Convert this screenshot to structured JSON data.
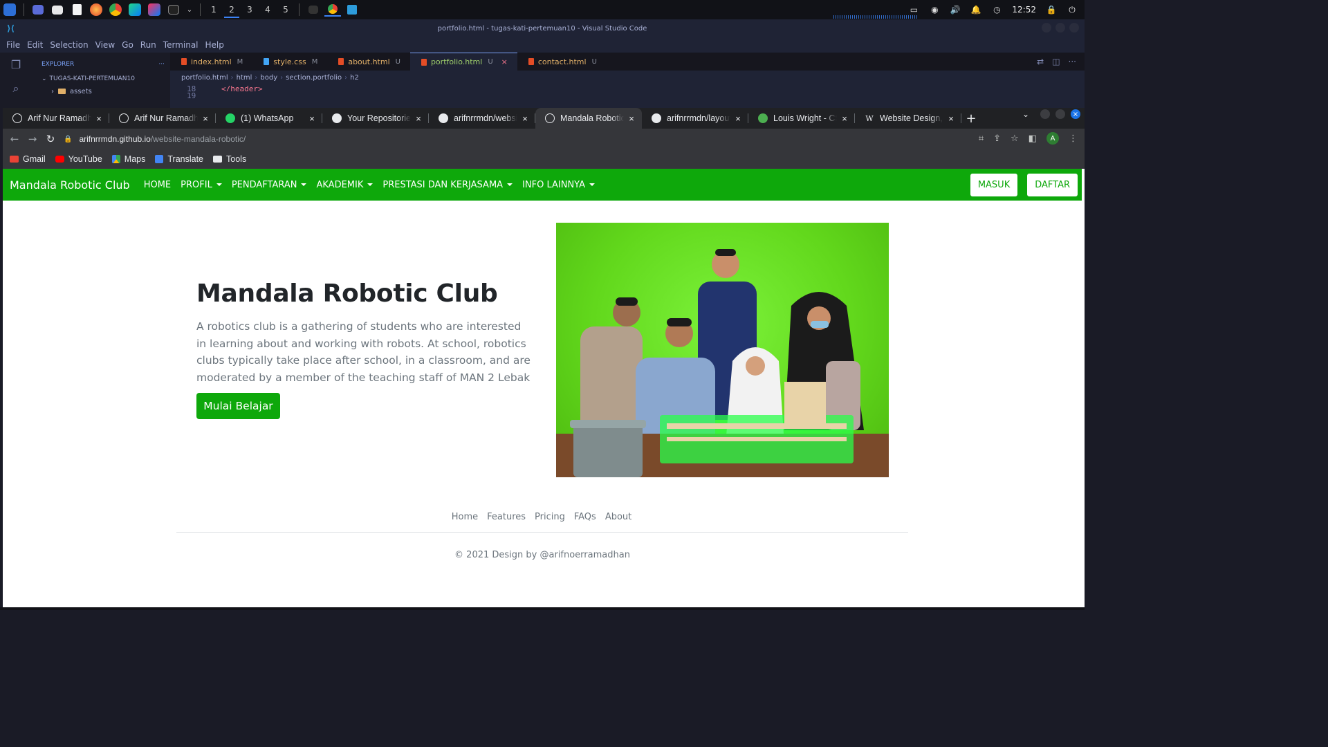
{
  "os": {
    "workspaces": [
      "1",
      "2",
      "3",
      "4",
      "5"
    ],
    "active_workspace": "2",
    "clock": "12:52"
  },
  "vscode": {
    "title": "portfolio.html - tugas-kati-pertemuan10 - Visual Studio Code",
    "menu": [
      "File",
      "Edit",
      "Selection",
      "View",
      "Go",
      "Run",
      "Terminal",
      "Help"
    ],
    "explorer_label": "EXPLORER",
    "explorer_more": "···",
    "project": "TUGAS-KATI-PERTEMUAN10",
    "folder": "assets",
    "tabs": [
      {
        "name": "index.html",
        "status": "M"
      },
      {
        "name": "style.css",
        "status": "M"
      },
      {
        "name": "about.html",
        "status": "U"
      },
      {
        "name": "portfolio.html",
        "status": "U"
      },
      {
        "name": "contact.html",
        "status": "U"
      }
    ],
    "breadcrumb": [
      "portfolio.html",
      "html",
      "body",
      "section.portfolio",
      "h2"
    ],
    "code_lines": [
      {
        "num": "18",
        "text": "</header>"
      },
      {
        "num": "19",
        "text": ""
      }
    ]
  },
  "chrome": {
    "tabs": [
      {
        "title": "Arif Nur Ramadhan",
        "icon": "globe-icon"
      },
      {
        "title": "Arif Nur Ramadhan",
        "icon": "globe-icon"
      },
      {
        "title": "(1) WhatsApp",
        "icon": "whatsapp-icon"
      },
      {
        "title": "Your Repositories",
        "icon": "github-icon"
      },
      {
        "title": "arifnrrmdn/website",
        "icon": "github-icon"
      },
      {
        "title": "Mandala Robotic Club",
        "icon": "globe-icon",
        "active": true
      },
      {
        "title": "arifnrrmdn/layout",
        "icon": "github-icon"
      },
      {
        "title": "Louis Wright - CSS",
        "icon": "leaf-icon"
      },
      {
        "title": "Website Design, D",
        "icon": "wikipedia-icon"
      }
    ],
    "url_host": "arifnrrmdn.github.io",
    "url_path": "/website-mandala-robotic/",
    "bookmarks": [
      "Gmail",
      "YouTube",
      "Maps",
      "Translate",
      "Tools"
    ],
    "avatar_letter": "A"
  },
  "site": {
    "brand": "Mandala Robotic Club",
    "nav": [
      {
        "label": "HOME",
        "dropdown": false
      },
      {
        "label": "PROFIL",
        "dropdown": true
      },
      {
        "label": "PENDAFTARAN",
        "dropdown": true
      },
      {
        "label": "AKADEMIK",
        "dropdown": true
      },
      {
        "label": "PRESTASI DAN KERJASAMA",
        "dropdown": true
      },
      {
        "label": "INFO LAINNYA",
        "dropdown": true
      }
    ],
    "login_label": "MASUK",
    "register_label": "DAFTAR",
    "hero": {
      "title": "Mandala Robotic Club",
      "text": "A robotics club is a gathering of students who are interested in learning about and working with robots. At school, robotics clubs typically take place after school, in a classroom, and are moderated by a member of the teaching staff of MAN 2 Lebak",
      "button": "Mulai Belajar"
    },
    "footer": {
      "links": [
        "Home",
        "Features",
        "Pricing",
        "FAQs",
        "About"
      ],
      "copyright": "© 2021 Design by @arifnoerramadhan"
    },
    "colors": {
      "primary": "#0ea80b",
      "text": "#212529",
      "muted": "#6c757d"
    }
  }
}
